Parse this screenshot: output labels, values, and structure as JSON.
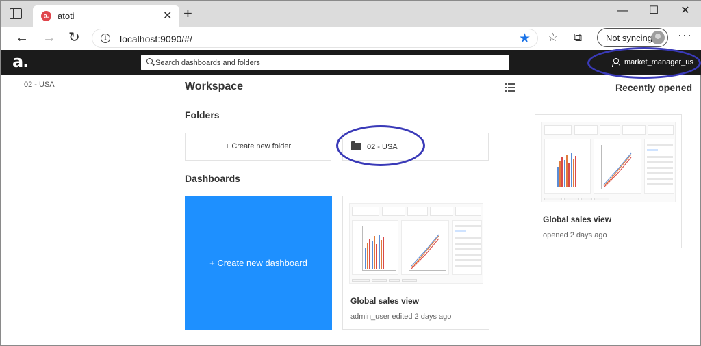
{
  "browser": {
    "tab_title": "atoti",
    "tab_favicon_letter": "a.",
    "url": "localhost:9090/#/",
    "sync_label": "Not syncing",
    "window_controls": [
      "minimize-icon",
      "maximize-icon",
      "close-icon"
    ],
    "accent_color": "#1a73e8"
  },
  "app": {
    "logo": "a.",
    "search_placeholder": "Search dashboards and folders",
    "user_name": "market_manager_us",
    "header_bg": "#1b1b1b"
  },
  "sidebar": {
    "current_folder": "02 - USA"
  },
  "workspace": {
    "title": "Workspace",
    "folders_label": "Folders",
    "create_folder_label": "+ Create new folder",
    "folders": [
      {
        "name": "02 - USA"
      }
    ],
    "dashboards_label": "Dashboards",
    "create_dashboard_label": "+ Create new dashboard",
    "create_dashboard_color": "#1e90ff",
    "dashboards": [
      {
        "title": "Global sales view",
        "meta": "admin_user edited 2 days ago"
      }
    ]
  },
  "recent": {
    "title": "Recently opened",
    "items": [
      {
        "title": "Global sales view",
        "meta": "opened 2 days ago"
      }
    ]
  },
  "annotation_color": "#3a3ab8"
}
